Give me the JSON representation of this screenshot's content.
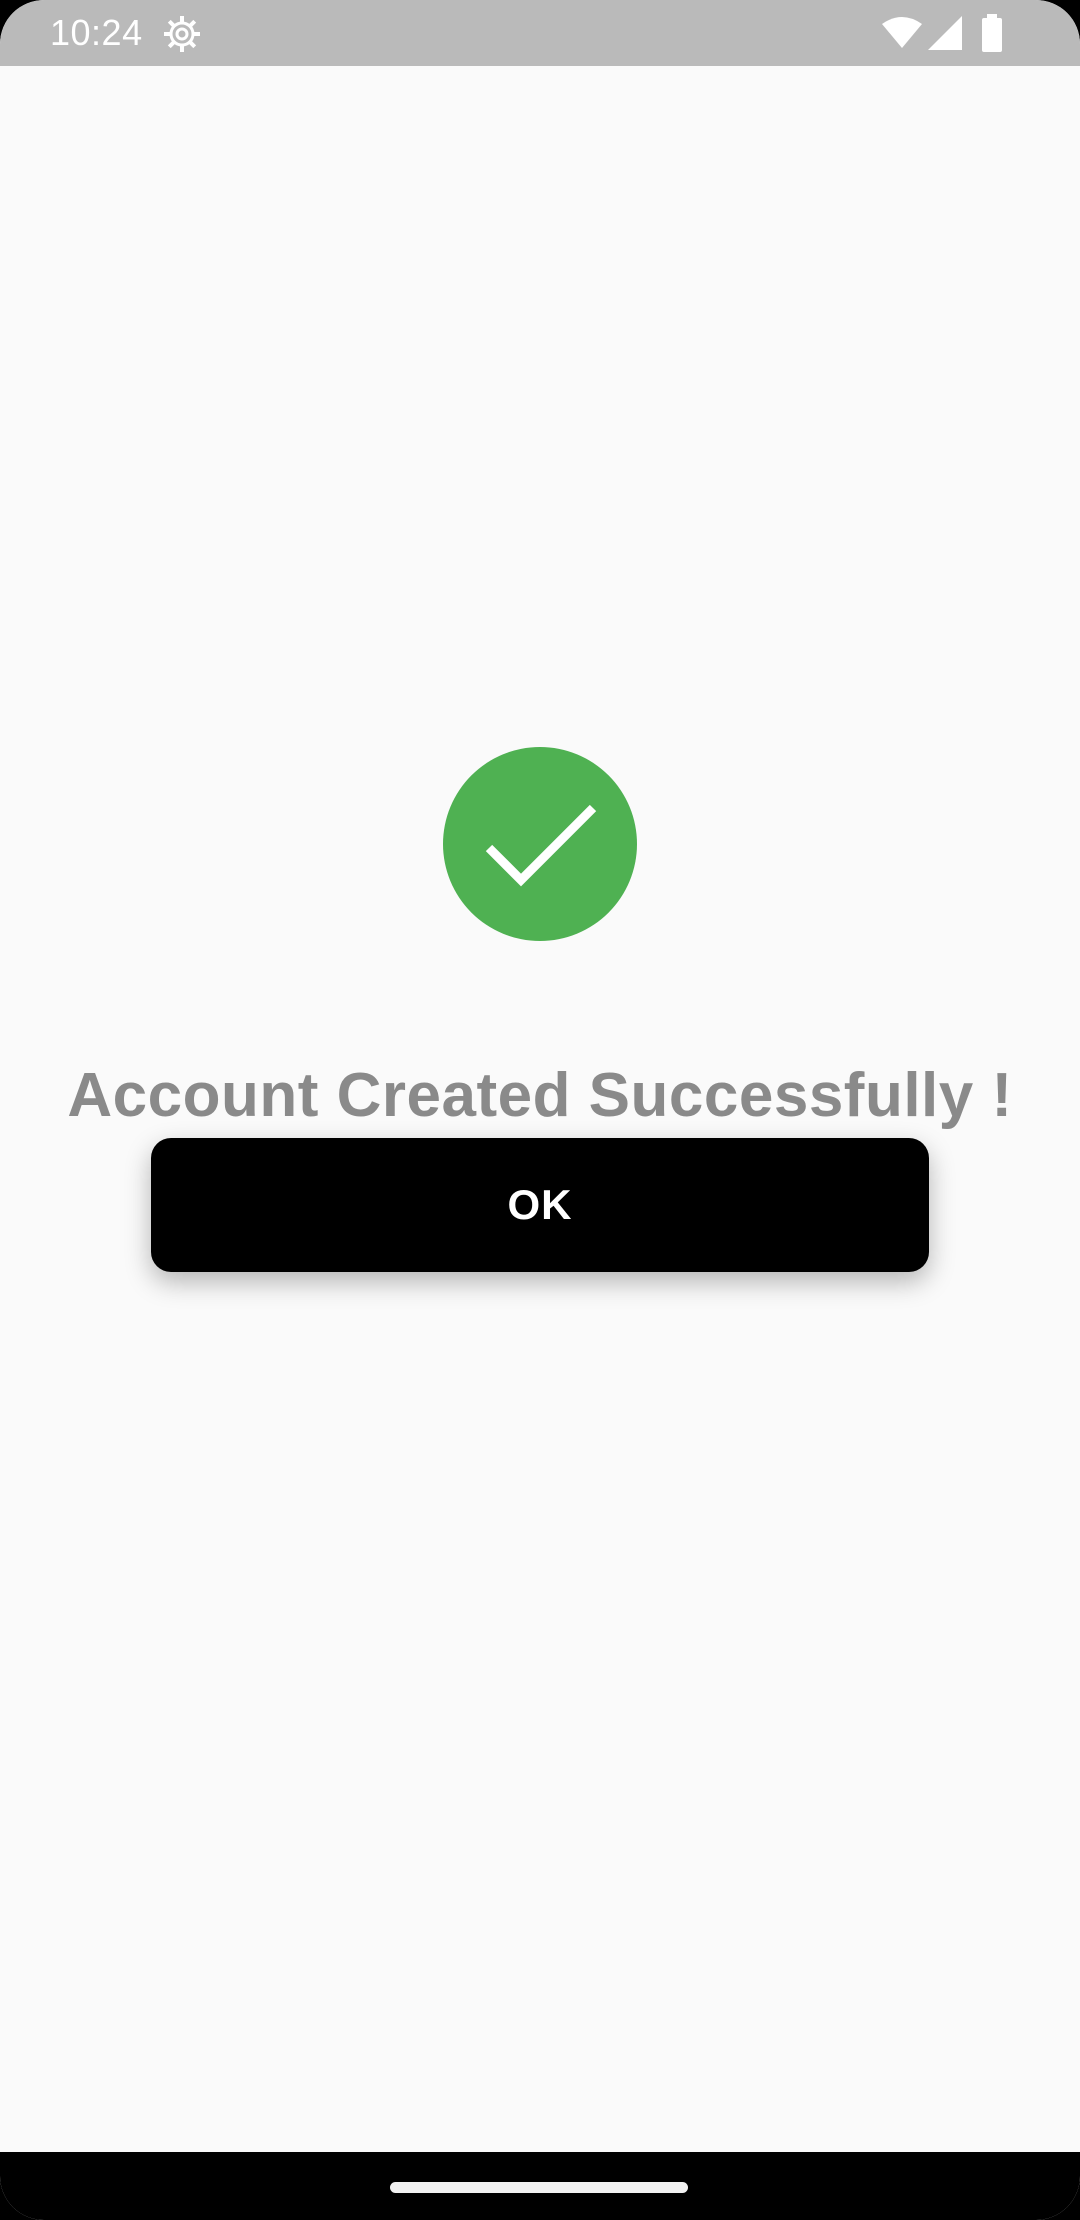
{
  "status_bar": {
    "time": "10:24",
    "icons": [
      "settings-gear-icon",
      "wifi-icon",
      "cell-signal-icon",
      "battery-icon"
    ]
  },
  "main": {
    "success_icon": "check-circle-icon",
    "title": "Account Created Successfully !",
    "ok_button_label": "OK"
  },
  "colors": {
    "success_green": "#4fb152",
    "title_gray": "#8a8a8a",
    "button_bg": "#000000",
    "status_bar_bg": "#bababa",
    "background": "#fafafa"
  }
}
